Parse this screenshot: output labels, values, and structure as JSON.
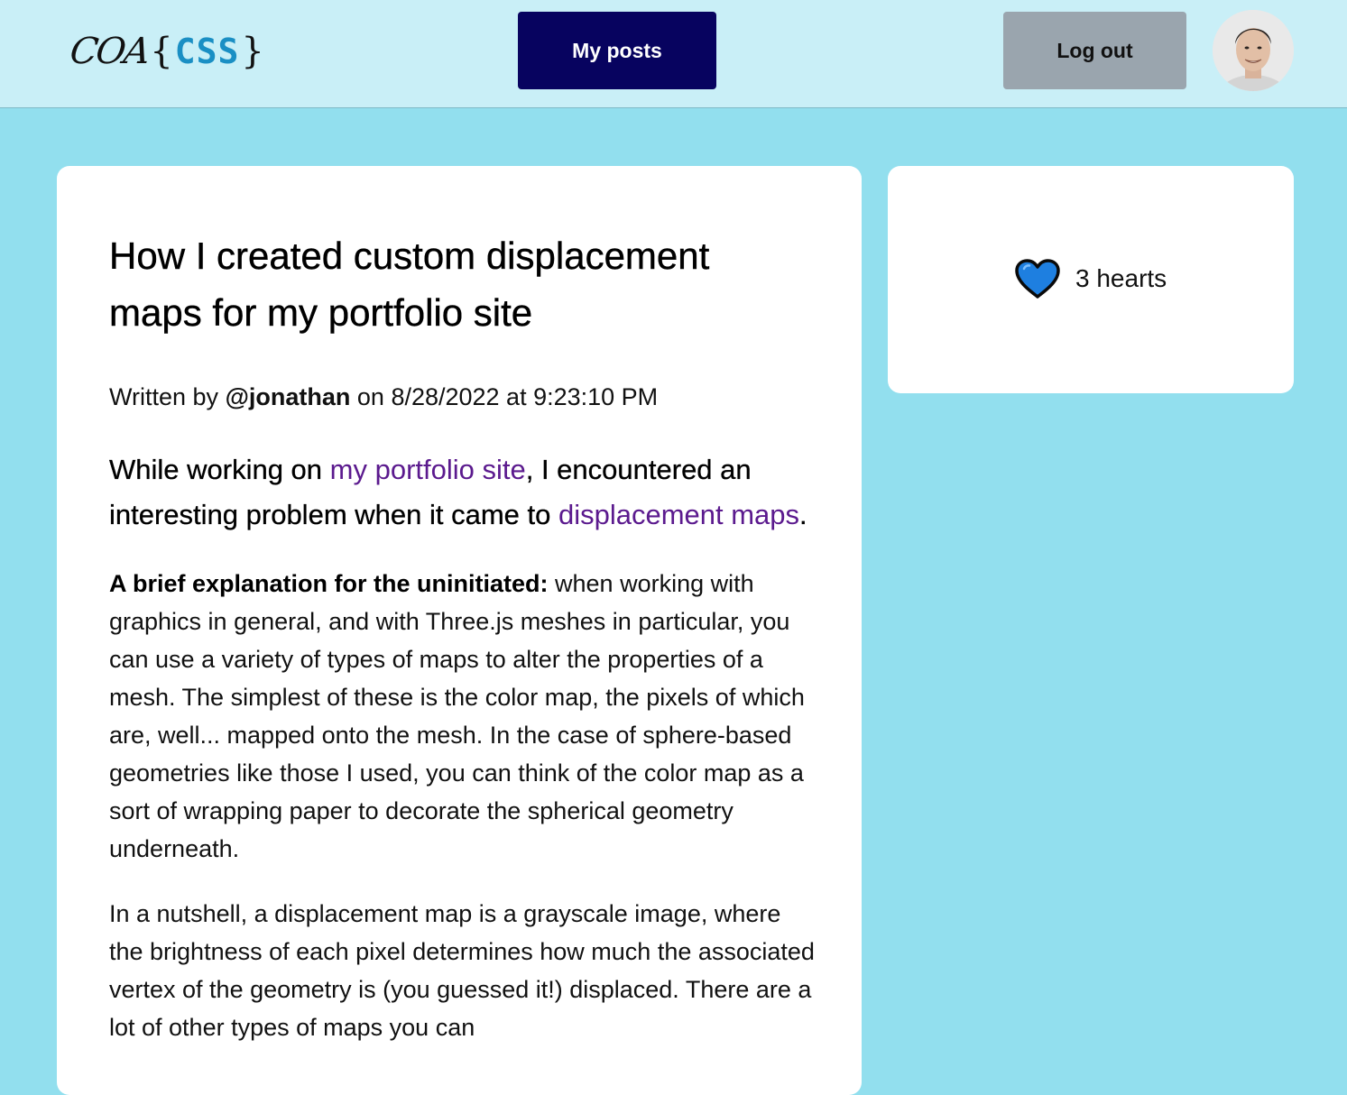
{
  "header": {
    "logo": {
      "left": "COA",
      "open_brace": "{",
      "accent": "CSS",
      "close_brace": "}"
    },
    "my_posts_label": "My posts",
    "logout_label": "Log out"
  },
  "post": {
    "title": "How I created custom displacement maps for my portfolio site",
    "byline": {
      "prefix": "Written by",
      "author": "@jonathan",
      "date_text": "on 8/28/2022 at 9:23:10 PM"
    },
    "lede": {
      "part1": "While working on ",
      "link1": "my portfolio site",
      "part2": ", I encountered an interesting problem when it came to ",
      "link2": "displacement maps",
      "part3": "."
    },
    "paragraph1": {
      "bold": "A brief explanation for the uninitiated:",
      "text": " when working with graphics in general, and with Three.js meshes in particular, you can use a variety of types of maps to alter the properties of a mesh. The simplest of these is the color map, the pixels of which are, well... mapped onto the mesh. In the case of sphere-based geometries like those I used, you can think of the color map as a sort of wrapping paper to decorate the spherical geometry underneath."
    },
    "paragraph2": "In a nutshell, a displacement map is a grayscale image, where the brightness of each pixel determines how much the associated vertex of the geometry is (you guessed it!) displaced. There are a lot of other types of maps you can"
  },
  "sidebar": {
    "hearts_label": "3 hearts"
  },
  "colors": {
    "page_bg": "#92dfee",
    "header_bg": "#c9eff7",
    "primary_button": "#07035f",
    "logout_button": "#9aa5ae",
    "link": "#5b1a8e",
    "heart": "#1e7fe0",
    "logo_accent": "#1a8fc4"
  },
  "icons": {
    "heart": "heart-icon",
    "avatar": "user-avatar"
  }
}
